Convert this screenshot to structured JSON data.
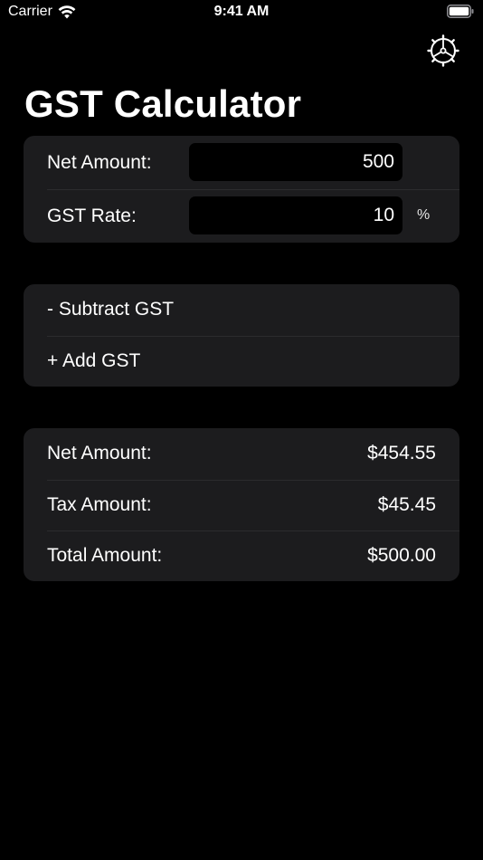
{
  "status_bar": {
    "carrier": "Carrier",
    "time": "9:41 AM",
    "wifi_icon": "wifi-icon",
    "battery_icon": "battery-icon"
  },
  "header": {
    "settings_icon": "gear-icon",
    "title": "GST Calculator"
  },
  "inputs": {
    "net_amount_label": "Net Amount:",
    "net_amount_value": "500",
    "gst_rate_label": "GST Rate:",
    "gst_rate_value": "10",
    "gst_rate_unit": "%"
  },
  "actions": {
    "subtract_label": "- Subtract GST",
    "add_label": "+ Add GST"
  },
  "results": {
    "net_label": "Net Amount:",
    "net_value": "$454.55",
    "tax_label": "Tax Amount:",
    "tax_value": "$45.45",
    "total_label": "Total Amount:",
    "total_value": "$500.00"
  },
  "colors": {
    "background": "#000000",
    "card": "#1c1c1e",
    "separator": "#2c2c2e",
    "text": "#ffffff"
  }
}
